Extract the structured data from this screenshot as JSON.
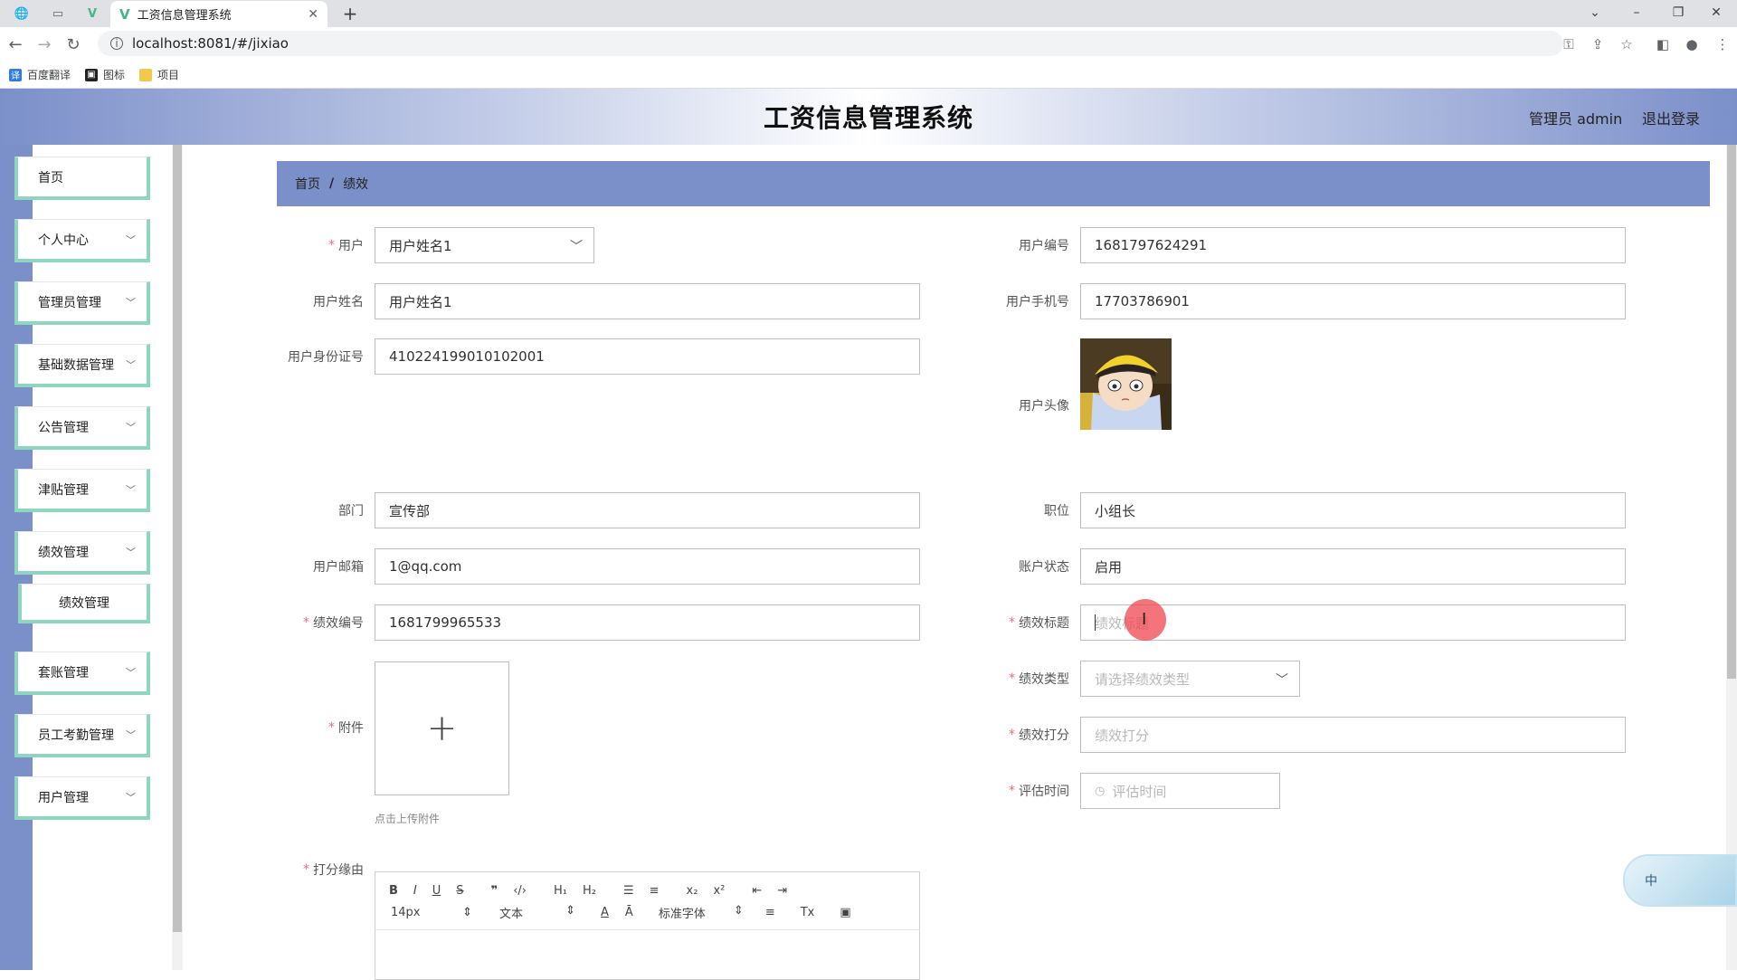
{
  "browser": {
    "tab_title": "工资信息管理系统",
    "url": "localhost:8081/#/jixiao",
    "bookmarks": [
      "百度翻译",
      "图标",
      "项目"
    ]
  },
  "header": {
    "title": "工资信息管理系统",
    "admin_label": "管理员 admin",
    "logout_label": "退出登录"
  },
  "sidebar": {
    "items": [
      {
        "label": "首页"
      },
      {
        "label": "个人中心"
      },
      {
        "label": "管理员管理"
      },
      {
        "label": "基础数据管理"
      },
      {
        "label": "公告管理"
      },
      {
        "label": "津贴管理"
      },
      {
        "label": "绩效管理"
      },
      {
        "label": "绩效管理"
      },
      {
        "label": "套账管理"
      },
      {
        "label": "员工考勤管理"
      },
      {
        "label": "用户管理"
      }
    ]
  },
  "breadcrumb": {
    "home": "首页",
    "sep": "/",
    "current": "绩效"
  },
  "form": {
    "user": {
      "label": "用户",
      "value": "用户姓名1"
    },
    "user_no": {
      "label": "用户编号",
      "value": "1681797624291"
    },
    "user_name": {
      "label": "用户姓名",
      "value": "用户姓名1"
    },
    "user_phone": {
      "label": "用户手机号",
      "value": "17703786901"
    },
    "user_id": {
      "label": "用户身份证号",
      "value": "410224199010102001"
    },
    "avatar": {
      "label": "用户头像"
    },
    "dept": {
      "label": "部门",
      "value": "宣传部"
    },
    "position": {
      "label": "职位",
      "value": "小组长"
    },
    "email": {
      "label": "用户邮箱",
      "value": "1@qq.com"
    },
    "account_status": {
      "label": "账户状态",
      "value": "启用"
    },
    "perf_no": {
      "label": "绩效编号",
      "value": "1681799965533"
    },
    "perf_title": {
      "label": "绩效标题",
      "placeholder": "绩效标题"
    },
    "perf_type": {
      "label": "绩效类型",
      "placeholder": "请选择绩效类型"
    },
    "perf_score": {
      "label": "绩效打分",
      "placeholder": "绩效打分"
    },
    "eval_time": {
      "label": "评估时间",
      "placeholder": "评估时间"
    },
    "attachment": {
      "label": "附件",
      "hint": "点击上传附件"
    },
    "reason": {
      "label": "打分缘由"
    }
  },
  "editor": {
    "font_size": "14px",
    "block_type": "文本",
    "font_family": "标准字体"
  },
  "ime": {
    "label": "中"
  }
}
